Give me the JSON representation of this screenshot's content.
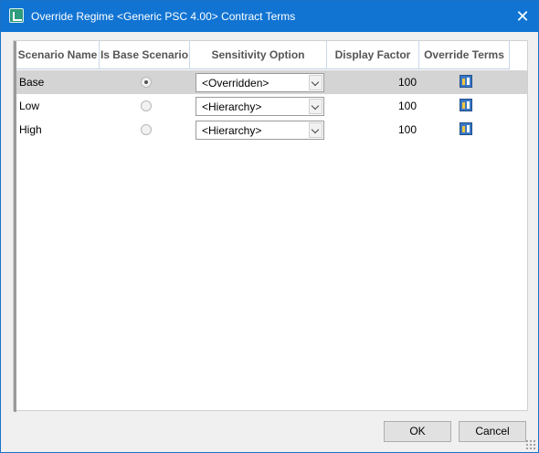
{
  "window": {
    "title": "Override Regime <Generic PSC 4.00> Contract Terms",
    "close_glyph": "✕",
    "icon": "app-chart-icon"
  },
  "grid": {
    "columns": [
      "Scenario Name",
      "Is Base Scenario",
      "Sensitivity Option",
      "Display Factor",
      "Override Terms"
    ],
    "rows": [
      {
        "name": "Base",
        "is_base": true,
        "sensitivity": "<Overridden>",
        "display_factor": "100",
        "terms_icon": "override-terms-icon",
        "selected": true
      },
      {
        "name": "Low",
        "is_base": false,
        "sensitivity": "<Hierarchy>",
        "display_factor": "100",
        "terms_icon": "override-terms-icon",
        "selected": false
      },
      {
        "name": "High",
        "is_base": false,
        "sensitivity": "<Hierarchy>",
        "display_factor": "100",
        "terms_icon": "override-terms-icon",
        "selected": false
      }
    ]
  },
  "footer": {
    "ok_label": "OK",
    "cancel_label": "Cancel"
  }
}
